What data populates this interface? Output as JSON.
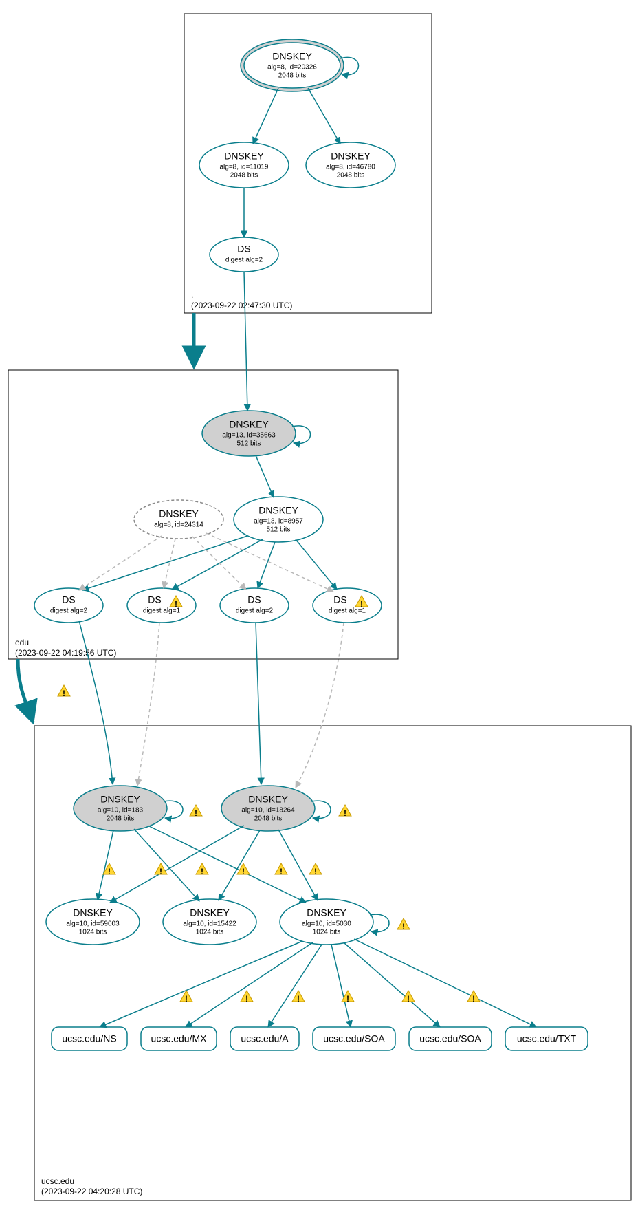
{
  "zones": {
    "root": {
      "name": ".",
      "ts": "(2023-09-22 02:47:30 UTC)"
    },
    "edu": {
      "name": "edu",
      "ts": "(2023-09-22 04:19:56 UTC)"
    },
    "ucsc": {
      "name": "ucsc.edu",
      "ts": "(2023-09-22 04:20:28 UTC)"
    }
  },
  "nodes": {
    "root_ksk": {
      "t": "DNSKEY",
      "l1": "alg=8, id=20326",
      "l2": "2048 bits"
    },
    "root_zsk1": {
      "t": "DNSKEY",
      "l1": "alg=8, id=11019",
      "l2": "2048 bits"
    },
    "root_zsk2": {
      "t": "DNSKEY",
      "l1": "alg=8, id=46780",
      "l2": "2048 bits"
    },
    "root_ds": {
      "t": "DS",
      "l1": "digest alg=2"
    },
    "edu_ksk": {
      "t": "DNSKEY",
      "l1": "alg=13, id=35663",
      "l2": "512 bits"
    },
    "edu_old": {
      "t": "DNSKEY",
      "l1": "alg=8, id=24314"
    },
    "edu_zsk": {
      "t": "DNSKEY",
      "l1": "alg=13, id=8957",
      "l2": "512 bits"
    },
    "ds_a": {
      "t": "DS",
      "l1": "digest alg=2"
    },
    "ds_b": {
      "t": "DS",
      "l1": "digest alg=1"
    },
    "ds_c": {
      "t": "DS",
      "l1": "digest alg=2"
    },
    "ds_d": {
      "t": "DS",
      "l1": "digest alg=1"
    },
    "uc_ksk1": {
      "t": "DNSKEY",
      "l1": "alg=10, id=183",
      "l2": "2048 bits"
    },
    "uc_ksk2": {
      "t": "DNSKEY",
      "l1": "alg=10, id=18264",
      "l2": "2048 bits"
    },
    "uc_zsk1": {
      "t": "DNSKEY",
      "l1": "alg=10, id=59003",
      "l2": "1024 bits"
    },
    "uc_zsk2": {
      "t": "DNSKEY",
      "l1": "alg=10, id=15422",
      "l2": "1024 bits"
    },
    "uc_zsk3": {
      "t": "DNSKEY",
      "l1": "alg=10, id=5030",
      "l2": "1024 bits"
    },
    "rr_ns": "ucsc.edu/NS",
    "rr_mx": "ucsc.edu/MX",
    "rr_a": "ucsc.edu/A",
    "rr_soa1": "ucsc.edu/SOA",
    "rr_soa2": "ucsc.edu/SOA",
    "rr_txt": "ucsc.edu/TXT"
  },
  "chart_data": {
    "type": "table",
    "title": "DNSSEC authentication chain for ucsc.edu",
    "zones": [
      {
        "name": ".",
        "timestamp": "2023-09-22 02:47:30 UTC",
        "keys": [
          {
            "role": "KSK",
            "type": "DNSKEY",
            "alg": 8,
            "id": 20326,
            "bits": 2048,
            "self_signed": true,
            "trust_anchor": true
          },
          {
            "role": "ZSK",
            "type": "DNSKEY",
            "alg": 8,
            "id": 11019,
            "bits": 2048
          },
          {
            "role": "ZSK",
            "type": "DNSKEY",
            "alg": 8,
            "id": 46780,
            "bits": 2048
          }
        ],
        "ds": [
          {
            "digest_alg": 2,
            "for": "edu"
          }
        ]
      },
      {
        "name": "edu",
        "timestamp": "2023-09-22 04:19:56 UTC",
        "keys": [
          {
            "role": "KSK",
            "type": "DNSKEY",
            "alg": 13,
            "id": 35663,
            "bits": 512,
            "self_signed": true
          },
          {
            "role": "unused",
            "type": "DNSKEY",
            "alg": 8,
            "id": 24314,
            "status": "inactive"
          },
          {
            "role": "ZSK",
            "type": "DNSKEY",
            "alg": 13,
            "id": 8957,
            "bits": 512
          }
        ],
        "ds": [
          {
            "digest_alg": 2,
            "for": "ucsc.edu",
            "warn": false
          },
          {
            "digest_alg": 1,
            "for": "ucsc.edu",
            "warn": true
          },
          {
            "digest_alg": 2,
            "for": "ucsc.edu",
            "warn": false
          },
          {
            "digest_alg": 1,
            "for": "ucsc.edu",
            "warn": true
          }
        ],
        "delegation_warning": true
      },
      {
        "name": "ucsc.edu",
        "timestamp": "2023-09-22 04:20:28 UTC",
        "keys": [
          {
            "role": "KSK",
            "type": "DNSKEY",
            "alg": 10,
            "id": 183,
            "bits": 2048,
            "self_signed": true,
            "warn": true
          },
          {
            "role": "KSK",
            "type": "DNSKEY",
            "alg": 10,
            "id": 18264,
            "bits": 2048,
            "self_signed": true,
            "warn": true
          },
          {
            "role": "ZSK",
            "type": "DNSKEY",
            "alg": 10,
            "id": 59003,
            "bits": 1024,
            "warn": true
          },
          {
            "role": "ZSK",
            "type": "DNSKEY",
            "alg": 10,
            "id": 15422,
            "bits": 1024,
            "warn": true
          },
          {
            "role": "ZSK",
            "type": "DNSKEY",
            "alg": 10,
            "id": 5030,
            "bits": 1024,
            "self_signed": true,
            "warn": true
          }
        ],
        "rrsets": [
          {
            "name": "ucsc.edu",
            "type": "NS",
            "warn": true
          },
          {
            "name": "ucsc.edu",
            "type": "MX",
            "warn": true
          },
          {
            "name": "ucsc.edu",
            "type": "A",
            "warn": true
          },
          {
            "name": "ucsc.edu",
            "type": "SOA",
            "warn": true
          },
          {
            "name": "ucsc.edu",
            "type": "SOA",
            "warn": true
          },
          {
            "name": "ucsc.edu",
            "type": "TXT",
            "warn": true
          }
        ]
      }
    ],
    "edges": [
      {
        "from": "./DNSKEY/20326",
        "to": "./DNSKEY/20326",
        "kind": "self-sig"
      },
      {
        "from": "./DNSKEY/20326",
        "to": "./DNSKEY/11019",
        "kind": "sig"
      },
      {
        "from": "./DNSKEY/20326",
        "to": "./DNSKEY/46780",
        "kind": "sig"
      },
      {
        "from": "./DNSKEY/11019",
        "to": "./DS(edu,2)",
        "kind": "sig"
      },
      {
        "from": "./DS(edu,2)",
        "to": "edu/DNSKEY/35663",
        "kind": "ds"
      },
      {
        "from": "edu/DNSKEY/35663",
        "to": "edu/DNSKEY/35663",
        "kind": "self-sig"
      },
      {
        "from": "edu/DNSKEY/35663",
        "to": "edu/DNSKEY/8957",
        "kind": "sig"
      },
      {
        "from": "edu/DNSKEY/8957",
        "to": "edu/DS(ucsc,2)a",
        "kind": "sig"
      },
      {
        "from": "edu/DNSKEY/8957",
        "to": "edu/DS(ucsc,1)b",
        "kind": "sig"
      },
      {
        "from": "edu/DNSKEY/8957",
        "to": "edu/DS(ucsc,2)c",
        "kind": "sig"
      },
      {
        "from": "edu/DNSKEY/8957",
        "to": "edu/DS(ucsc,1)d",
        "kind": "sig"
      },
      {
        "from": "edu/DNSKEY/24314",
        "to": "edu/DS(ucsc,2)a",
        "kind": "dashed"
      },
      {
        "from": "edu/DNSKEY/24314",
        "to": "edu/DS(ucsc,1)b",
        "kind": "dashed"
      },
      {
        "from": "edu/DNSKEY/24314",
        "to": "edu/DS(ucsc,2)c",
        "kind": "dashed"
      },
      {
        "from": "edu/DNSKEY/24314",
        "to": "edu/DS(ucsc,1)d",
        "kind": "dashed"
      },
      {
        "from": "edu/DS(ucsc,2)a",
        "to": "ucsc/DNSKEY/183",
        "kind": "ds"
      },
      {
        "from": "edu/DS(ucsc,1)b",
        "to": "ucsc/DNSKEY/183",
        "kind": "ds-dashed"
      },
      {
        "from": "edu/DS(ucsc,2)c",
        "to": "ucsc/DNSKEY/18264",
        "kind": "ds"
      },
      {
        "from": "edu/DS(ucsc,1)d",
        "to": "ucsc/DNSKEY/18264",
        "kind": "ds-dashed"
      },
      {
        "from": "ucsc/DNSKEY/183",
        "to": "ucsc/DNSKEY/183",
        "kind": "self-sig",
        "warn": true
      },
      {
        "from": "ucsc/DNSKEY/18264",
        "to": "ucsc/DNSKEY/18264",
        "kind": "self-sig",
        "warn": true
      },
      {
        "from": "ucsc/DNSKEY/183",
        "to": "ucsc/DNSKEY/59003",
        "kind": "sig",
        "warn": true
      },
      {
        "from": "ucsc/DNSKEY/183",
        "to": "ucsc/DNSKEY/15422",
        "kind": "sig",
        "warn": true
      },
      {
        "from": "ucsc/DNSKEY/183",
        "to": "ucsc/DNSKEY/5030",
        "kind": "sig",
        "warn": true
      },
      {
        "from": "ucsc/DNSKEY/18264",
        "to": "ucsc/DNSKEY/59003",
        "kind": "sig",
        "warn": true
      },
      {
        "from": "ucsc/DNSKEY/18264",
        "to": "ucsc/DNSKEY/15422",
        "kind": "sig",
        "warn": true
      },
      {
        "from": "ucsc/DNSKEY/18264",
        "to": "ucsc/DNSKEY/5030",
        "kind": "sig",
        "warn": true
      },
      {
        "from": "ucsc/DNSKEY/5030",
        "to": "ucsc/DNSKEY/5030",
        "kind": "self-sig",
        "warn": true
      },
      {
        "from": "ucsc/DNSKEY/5030",
        "to": "ucsc.edu/NS",
        "kind": "sig",
        "warn": true
      },
      {
        "from": "ucsc/DNSKEY/5030",
        "to": "ucsc.edu/MX",
        "kind": "sig",
        "warn": true
      },
      {
        "from": "ucsc/DNSKEY/5030",
        "to": "ucsc.edu/A",
        "kind": "sig",
        "warn": true
      },
      {
        "from": "ucsc/DNSKEY/5030",
        "to": "ucsc.edu/SOA",
        "kind": "sig",
        "warn": true
      },
      {
        "from": "ucsc/DNSKEY/5030",
        "to": "ucsc.edu/SOA",
        "kind": "sig",
        "warn": true
      },
      {
        "from": "ucsc/DNSKEY/5030",
        "to": "ucsc.edu/TXT",
        "kind": "sig",
        "warn": true
      }
    ]
  }
}
